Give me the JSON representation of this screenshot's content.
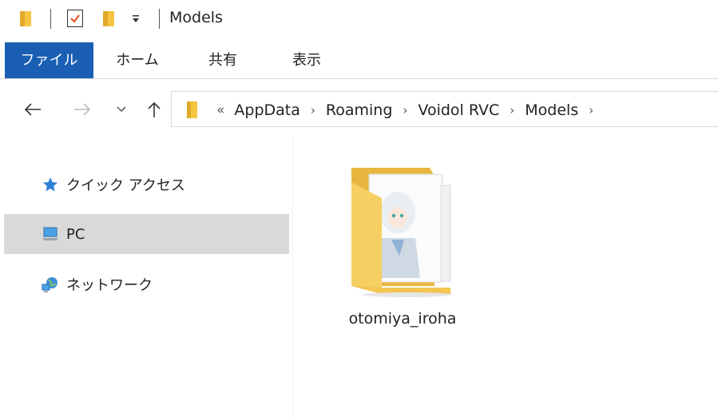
{
  "window": {
    "title": "Models"
  },
  "ribbon": {
    "tabs": [
      {
        "label": "ファイル",
        "active": true
      },
      {
        "label": "ホーム",
        "active": false
      },
      {
        "label": "共有",
        "active": false
      },
      {
        "label": "表示",
        "active": false
      }
    ],
    "accent_color": "#1a5fb4"
  },
  "nav": {
    "back_icon": "back-arrow-icon",
    "forward_icon": "forward-arrow-icon",
    "recent_icon": "chevron-down-icon",
    "up_icon": "up-arrow-icon"
  },
  "address": {
    "overflow": "«",
    "crumbs": [
      "AppData",
      "Roaming",
      "Voidol RVC",
      "Models"
    ],
    "separator": "›"
  },
  "sidebar": {
    "items": [
      {
        "label": "クイック アクセス",
        "icon": "star-icon",
        "selected": false
      },
      {
        "label": "PC",
        "icon": "pc-icon",
        "selected": true
      },
      {
        "label": "ネットワーク",
        "icon": "network-icon",
        "selected": false
      }
    ]
  },
  "content": {
    "items": [
      {
        "name": "otomiya_iroha",
        "type": "folder"
      }
    ]
  }
}
